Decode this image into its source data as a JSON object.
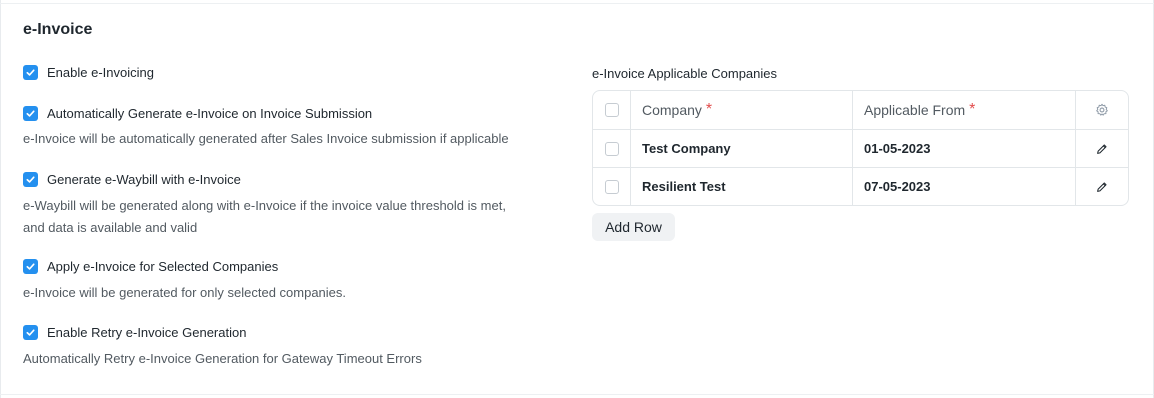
{
  "section": {
    "title": "e-Invoice"
  },
  "settings": [
    {
      "label": "Enable e-Invoicing",
      "checked": true,
      "description": ""
    },
    {
      "label": "Automatically Generate e-Invoice on Invoice Submission",
      "checked": true,
      "description": "e-Invoice will be automatically generated after Sales Invoice submission if applicable"
    },
    {
      "label": "Generate e-Waybill with e-Invoice",
      "checked": true,
      "description_lines": [
        "e-Waybill will be generated along with e-Invoice if the invoice value threshold is met,",
        "and data is available and valid"
      ]
    },
    {
      "label": "Apply e-Invoice for Selected Companies",
      "checked": true,
      "description": "e-Invoice will be generated for only selected companies."
    },
    {
      "label": "Enable Retry e-Invoice Generation",
      "checked": true,
      "description": "Automatically Retry e-Invoice Generation for Gateway Timeout Errors"
    }
  ],
  "companies_table": {
    "label": "e-Invoice Applicable Companies",
    "columns": [
      "Company",
      "Applicable From"
    ],
    "required_marker": "*",
    "rows": [
      {
        "company": "Test Company",
        "applicable_from": "01-05-2023"
      },
      {
        "company": "Resilient Test",
        "applicable_from": "07-05-2023"
      }
    ],
    "add_row_label": "Add Row"
  },
  "colors": {
    "accent": "#2490ef",
    "required": "#e24c4c"
  },
  "icons": {
    "settings": "gear-icon",
    "edit": "pencil-icon",
    "check": "checkmark-icon"
  }
}
